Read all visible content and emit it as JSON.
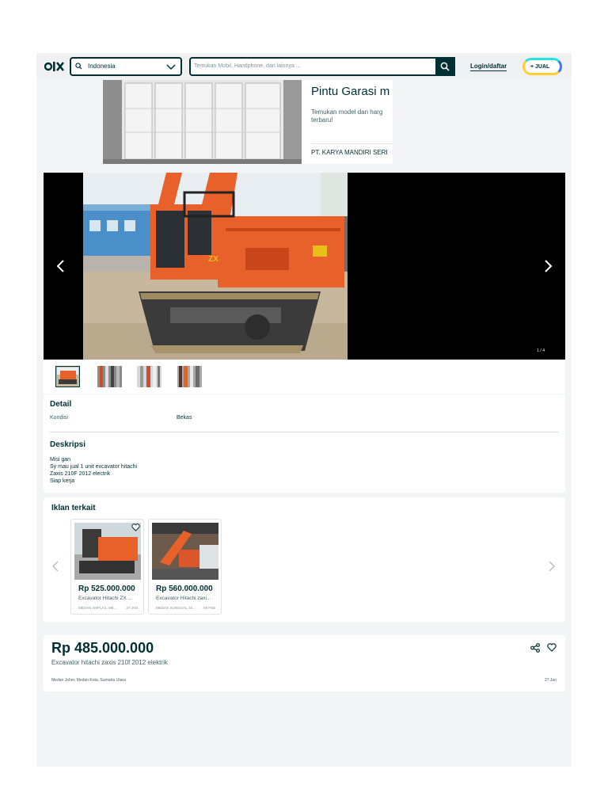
{
  "header": {
    "location": "Indonesia",
    "search_placeholder": "Temukan Mobil, Handphone, dan lainnya ...",
    "login": "Login/daftar",
    "sell": "+ JUAL"
  },
  "ad": {
    "title": "Pintu Garasi m",
    "description": "Temukan model dan harg terbaru!",
    "company": "PT. KARYA MANDIRI SERI"
  },
  "gallery": {
    "counter": "1 / 4"
  },
  "detail": {
    "heading": "Detail",
    "condition_label": "Kondisi",
    "condition_value": "Bekas",
    "desc_heading": "Deskripsi",
    "description": "Misi gan\nSy mau jual 1 unit excavator hitachi\nZaxis 210F 2012 electrik\nSiap kerja"
  },
  "related": {
    "heading": "Iklan terkait",
    "items": [
      {
        "price": "Rp 525.000.000",
        "name": "Excavator Hitachi ZX ...",
        "location": "MEDAN AMPLAS, ME...",
        "date": "27 JAN"
      },
      {
        "price": "Rp 560.000.000",
        "name": "Excavator Hitachi zaxi...",
        "location": "MEDAN SUNGGAL, M...",
        "date": "09 FEB"
      }
    ]
  },
  "listing": {
    "price": "Rp 485.000.000",
    "title": "Excavator hitachi zaxis 210f 2012 elektrik",
    "location": "Medan Johor, Medan Kota, Sumatra Utara",
    "date": "27 Jan"
  },
  "colors": {
    "brand": "#002f34",
    "accent_orange": "#e8612a"
  }
}
